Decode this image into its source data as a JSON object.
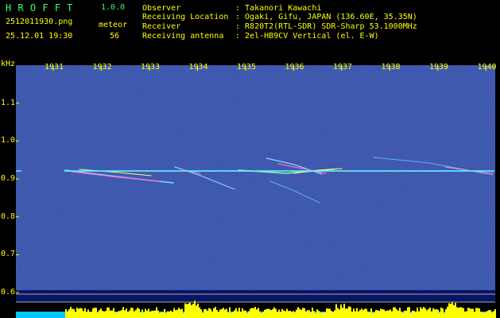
{
  "header": {
    "app_title": "HROFFT",
    "app_version": "1.0.0",
    "file_name": "2512011930.png",
    "detection_label": "meteor",
    "timestamp": "25.12.01 19:30",
    "detection_count": "56"
  },
  "station_info": [
    {
      "label": "Observer",
      "value": ": Takanori Kawachi"
    },
    {
      "label": "Receiving Location",
      "value": ": Ogaki, Gifu, JAPAN (136.60E, 35.35N)"
    },
    {
      "label": "Receiver",
      "value": ": R820T2(RTL-SDR) SDR-Sharp 53.1000MHz"
    },
    {
      "label": "Receiving antenna",
      "value": ": 2el-HB9CV Vertical (el. E-W)"
    }
  ],
  "spectrogram": {
    "freq_unit": "kHz",
    "time_ticks": [
      "1931",
      "1932",
      "1933",
      "1934",
      "1935",
      "1936",
      "1937",
      "1938",
      "1939",
      "1940"
    ],
    "freq_ticks": [
      "1.1",
      "1.0",
      "0.9",
      "0.8",
      "0.7",
      "0.6"
    ],
    "freq_min_khz": 0.55,
    "freq_max_khz": 1.2,
    "carrier_khz": 0.921
  },
  "colors": {
    "background": "#000000",
    "text_green": "#33ff66",
    "text_yellow": "#ffff00",
    "spectrogram_noise": "#0a1a8c",
    "carrier_line": "#66eeff",
    "power_bar": "#ffff00",
    "power_bar_base": "#00c8ff",
    "reference_line": "#aaaaaa"
  }
}
